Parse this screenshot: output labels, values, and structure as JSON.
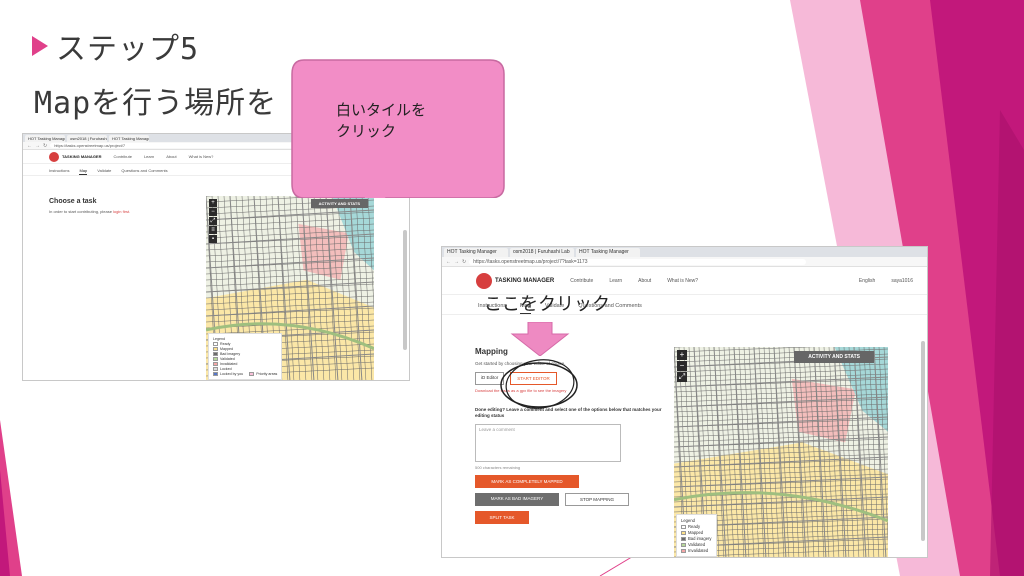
{
  "slide": {
    "step_title": "ステップ5",
    "subtitle": "Mapを行う場所を"
  },
  "callout": {
    "text_line1": "白いタイルを",
    "text_line2": "クリック",
    "color": "#f28dc6"
  },
  "annotation": {
    "click_here": "ここをクリック",
    "arrow_color": "#ee8ac2"
  },
  "colors": {
    "magenta": "#c2187b",
    "pink": "#e0408a",
    "light_pink": "#f6b9d8",
    "accent_orange": "#e5582a"
  },
  "shot1": {
    "tabs": [
      "HOT Tasking Manager",
      "osm2018 | Furuhashi Lab",
      "HOT Tasking Manager"
    ],
    "url": "https://tasks.openstreetmap.us/project/7",
    "nav": [
      "TASKING MANAGER",
      "Contribute",
      "Learn",
      "About",
      "What is New?"
    ],
    "subtabs": [
      "Instructions",
      "Map",
      "Validate",
      "Questions and Comments"
    ],
    "panel_title": "Choose a task",
    "panel_text": "In order to start contributing, please ",
    "panel_link": "login first.",
    "stats_button": "ACTIVITY AND STATS",
    "legend_title": "Legend",
    "legend_items": [
      "Ready",
      "Mapped",
      "Bad imagery",
      "Validated",
      "Invalidated",
      "Locked",
      "Locked by you",
      "Priority areas"
    ]
  },
  "shot2": {
    "tabs": [
      "HOT Tasking Manager",
      "osm2018 | Furuhashi Lab",
      "HOT Tasking Manager"
    ],
    "url": "https://tasks.openstreetmap.us/project/7?task=1173",
    "nav": [
      "TASKING MANAGER",
      "Contribute",
      "Learn",
      "About",
      "What is New?"
    ],
    "lang": "English",
    "user": "saya1016",
    "subtabs": [
      "Instructions",
      "Map",
      "Validate",
      "Questions and Comments"
    ],
    "panel_title": "Mapping",
    "panel_text": "Get started by choosing your editor of choice.",
    "editor_label": "iD Editor",
    "start_editor": "START EDITOR",
    "download_text": "Download the tasks as a gpx file to see the imagery",
    "done_text": "Done editing? Leave a comment and select one of the options below that matches your editing status",
    "comment_placeholder": "Leave a comment",
    "chars_remaining": "500 characters remaining",
    "btn_mapped": "MARK AS COMPLETELY MAPPED",
    "btn_bad": "MARK AS BAD IMAGERY",
    "btn_stop": "STOP MAPPING",
    "btn_split": "SPLIT TASK",
    "stats_button": "ACTIVITY AND STATS",
    "legend_title": "Legend",
    "legend_items": [
      "Ready",
      "Mapped",
      "Bad imagery",
      "Validated",
      "Invalidated"
    ]
  }
}
